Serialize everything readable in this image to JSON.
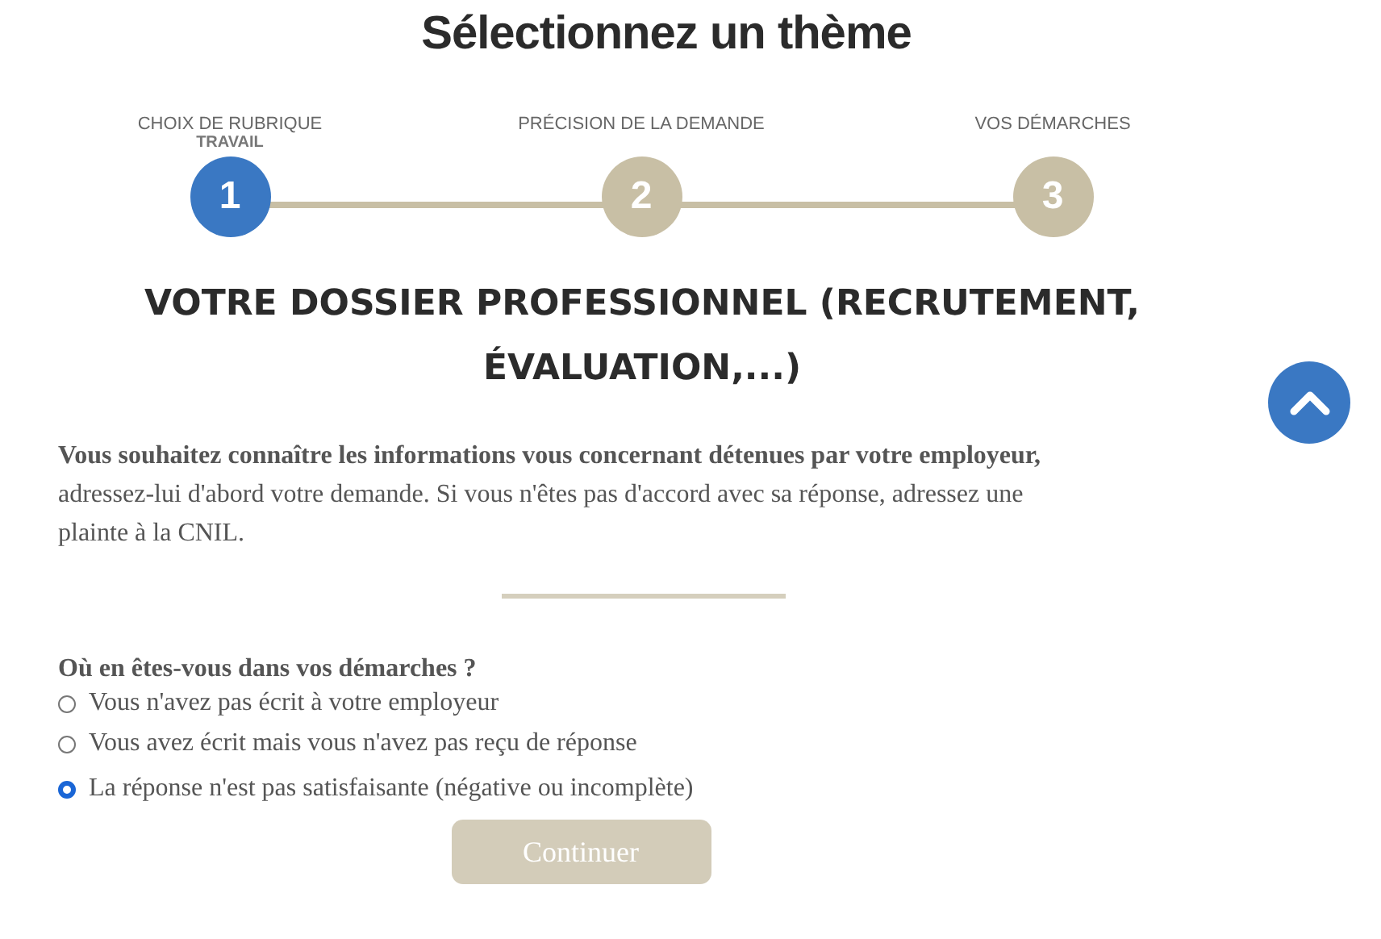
{
  "title": "Sélectionnez un thème",
  "steps": [
    {
      "label": "CHOIX DE RUBRIQUE",
      "detail": "TRAVAIL",
      "number": "1",
      "selected": true
    },
    {
      "label": "PRÉCISION DE LA DEMANDE",
      "number": "2",
      "selected": false
    },
    {
      "label": "VOS DÉMARCHES",
      "number": "3",
      "selected": false
    }
  ],
  "heading": "VOTRE DOSSIER PROFESSIONNEL (RECRUTEMENT, ÉVALUATION,...)",
  "intro": "**Vous souhaitez connaître les informations vous concernant détenues par votre employeur,** adressez-lui d'abord votre demande. Si vous n'êtes pas d'accord avec sa réponse, adressez une plainte à la CNIL.",
  "question": "Où en êtes-vous dans vos démarches ?",
  "options": [
    {
      "label": "Vous n'avez pas écrit à votre employeur",
      "selected": false
    },
    {
      "label": "Vous avez écrit mais vous n'avez pas reçu de réponse",
      "selected": false
    },
    {
      "label": "La réponse n'est pas satisfaisante (négative ou incomplète)",
      "selected": true
    }
  ],
  "button": "Continuer"
}
